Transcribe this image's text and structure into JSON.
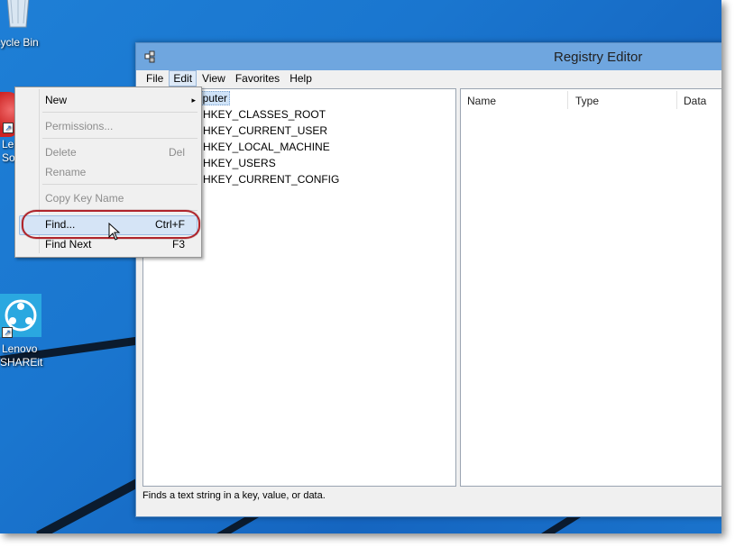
{
  "desktop": {
    "icons": [
      {
        "label": "ecycle Bin"
      },
      {
        "label1": "Le",
        "label2": "So"
      },
      {
        "label1": "Lenovo",
        "label2": "SHAREit"
      }
    ]
  },
  "window": {
    "title": "Registry Editor",
    "menu": [
      "File",
      "Edit",
      "View",
      "Favorites",
      "Help"
    ],
    "tree": {
      "root": "nputer",
      "keys": [
        "HKEY_CLASSES_ROOT",
        "HKEY_CURRENT_USER",
        "HKEY_LOCAL_MACHINE",
        "HKEY_USERS",
        "HKEY_CURRENT_CONFIG"
      ]
    },
    "columns": [
      "Name",
      "Type",
      "Data"
    ],
    "status": "Finds a text string in a key, value, or data."
  },
  "edit_menu": {
    "items": [
      {
        "label": "New",
        "shortcut": "",
        "submenu": "▸"
      },
      {
        "label": "Permissions...",
        "shortcut": ""
      },
      {
        "label": "Delete",
        "shortcut": "Del"
      },
      {
        "label": "Rename",
        "shortcut": ""
      },
      {
        "label": "Copy Key Name",
        "shortcut": ""
      },
      {
        "label": "Find...",
        "shortcut": "Ctrl+F"
      },
      {
        "label": "Find Next",
        "shortcut": "F3"
      }
    ]
  },
  "colors": {
    "desktop": "#1a76cf",
    "titlebar": "#6fa6df",
    "highlight_oval": "#b0242b"
  }
}
